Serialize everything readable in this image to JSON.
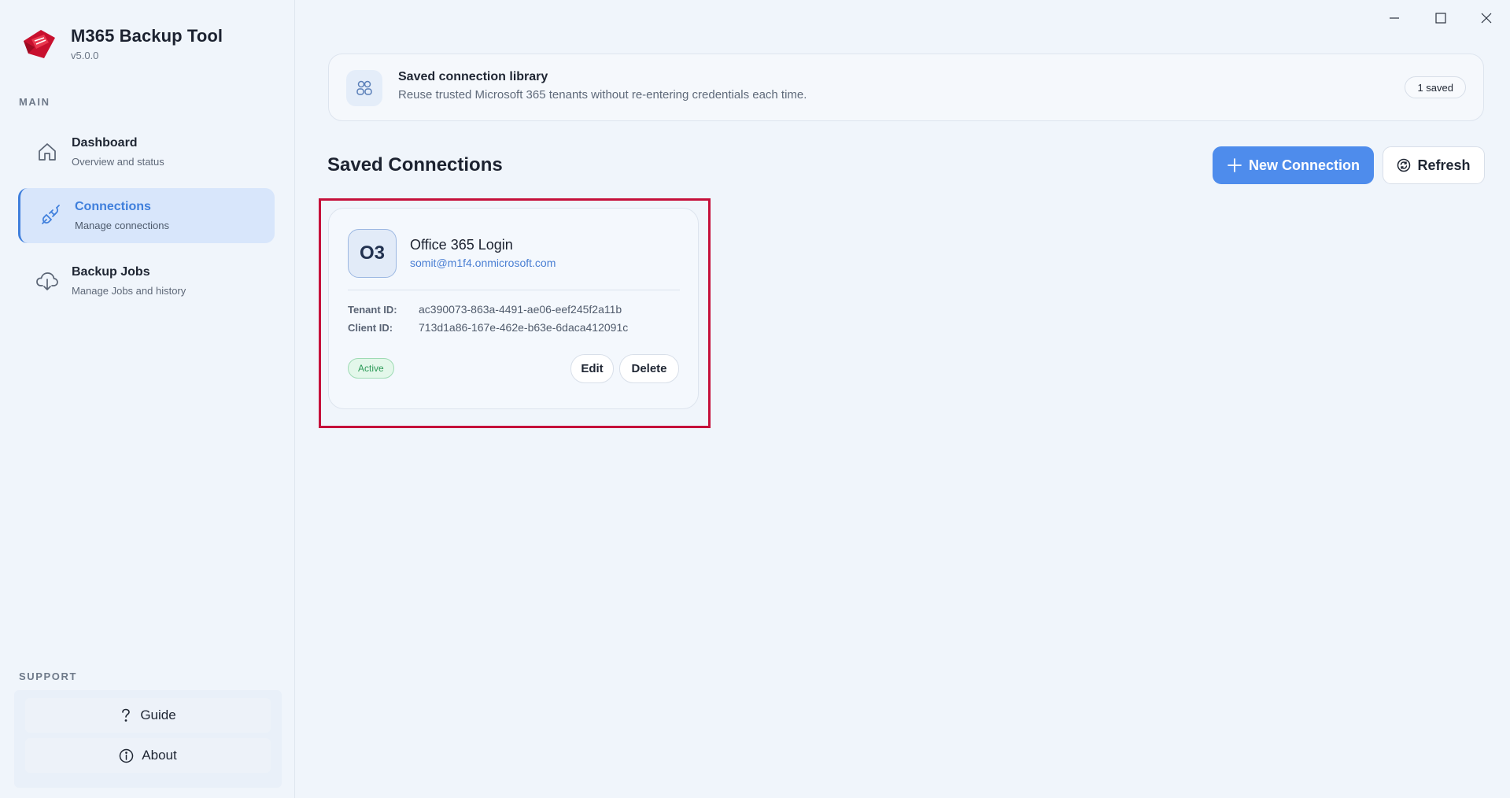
{
  "app": {
    "title": "M365 Backup Tool",
    "version": "v5.0.0",
    "accent_color": "#4e8cec",
    "logo_color": "#c8102e"
  },
  "sidebar": {
    "main_label": "MAIN",
    "items": [
      {
        "title": "Dashboard",
        "subtitle": "Overview and status",
        "icon": "home-icon"
      },
      {
        "title": "Connections",
        "subtitle": "Manage connections",
        "icon": "plug-icon",
        "active": true
      },
      {
        "title": "Backup Jobs",
        "subtitle": "Manage Jobs and history",
        "icon": "cloud-download-icon"
      }
    ],
    "support_label": "SUPPORT",
    "support_items": [
      {
        "label": "Guide",
        "icon": "question-icon"
      },
      {
        "label": "About",
        "icon": "info-icon"
      }
    ]
  },
  "banner": {
    "title": "Saved connection library",
    "subtitle": "Reuse trusted Microsoft 365 tenants without re-entering credentials each time.",
    "badge": "1 saved",
    "icon": "users-icon"
  },
  "header": {
    "title": "Saved Connections",
    "new_connection_label": "New Connection",
    "refresh_label": "Refresh"
  },
  "connections": [
    {
      "initials": "O3",
      "name": "Office 365 Login",
      "email": "somit@m1f4.onmicrosoft.com",
      "tenant_label": "Tenant ID:",
      "tenant_id": "ac390073-863a-4491-ae06-eef245f2a11b",
      "client_label": "Client ID:",
      "client_id": "713d1a86-167e-462e-b63e-6daca412091c",
      "status": "Active",
      "status_color": "#2c9a57",
      "edit_label": "Edit",
      "delete_label": "Delete"
    }
  ]
}
